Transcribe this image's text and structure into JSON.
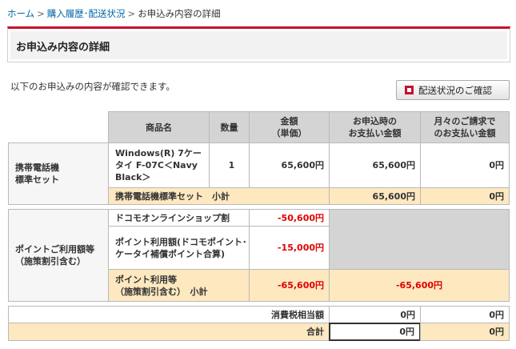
{
  "breadcrumb": {
    "home": "ホーム",
    "history": "購入履歴･配送状況",
    "current": "お申込み内容の詳細",
    "sep": ">"
  },
  "page_title": "お申込み内容の詳細",
  "intro_text": "以下のお申込みの内容が確認できます。",
  "status_button_label": "配送状況のご確認",
  "table": {
    "headers": {
      "product": "商品名",
      "qty": "数量",
      "amount": "金額\n（単価）",
      "pay_at_order": "お申込時の\nお支払い金額",
      "monthly": "月々のご請求で\nのお支払い金額"
    },
    "section1": {
      "label": "携帯電話機\n標準セット",
      "product": "Windows(R) 7ケータイ F-07C＜Navy Black＞",
      "qty": "1",
      "amount": "65,600円",
      "pay_at_order": "65,600円",
      "monthly": "0円",
      "subtotal_label": "携帯電話機標準セット　小計",
      "subtotal_pay_at_order": "65,600円",
      "subtotal_monthly": "0円"
    },
    "section2": {
      "label": "ポイントご利用額等\n（施策割引含む）",
      "item1_label": "ドコモオンラインショップ割",
      "item1_amount": "-50,600円",
      "item2_label": "ポイント利用額(ドコモポイント･ケータイ補償ポイント合算)",
      "item2_amount": "-15,000円",
      "subtotal_label": "ポイント利用等\n（施策割引含む）　小計",
      "subtotal_amount": "-65,600円",
      "subtotal_combined": "-65,600円"
    },
    "tax": {
      "label": "消費税相当額",
      "pay_at_order": "0円",
      "monthly": "0円"
    },
    "total": {
      "label": "合計",
      "pay_at_order": "0円",
      "monthly": "0円"
    }
  },
  "colors": {
    "accent": "#c8102e",
    "link": "#0066a8",
    "header_bg": "#d4d4d4",
    "subtotal_bg": "#fde8c0",
    "negative": "#e00000"
  }
}
